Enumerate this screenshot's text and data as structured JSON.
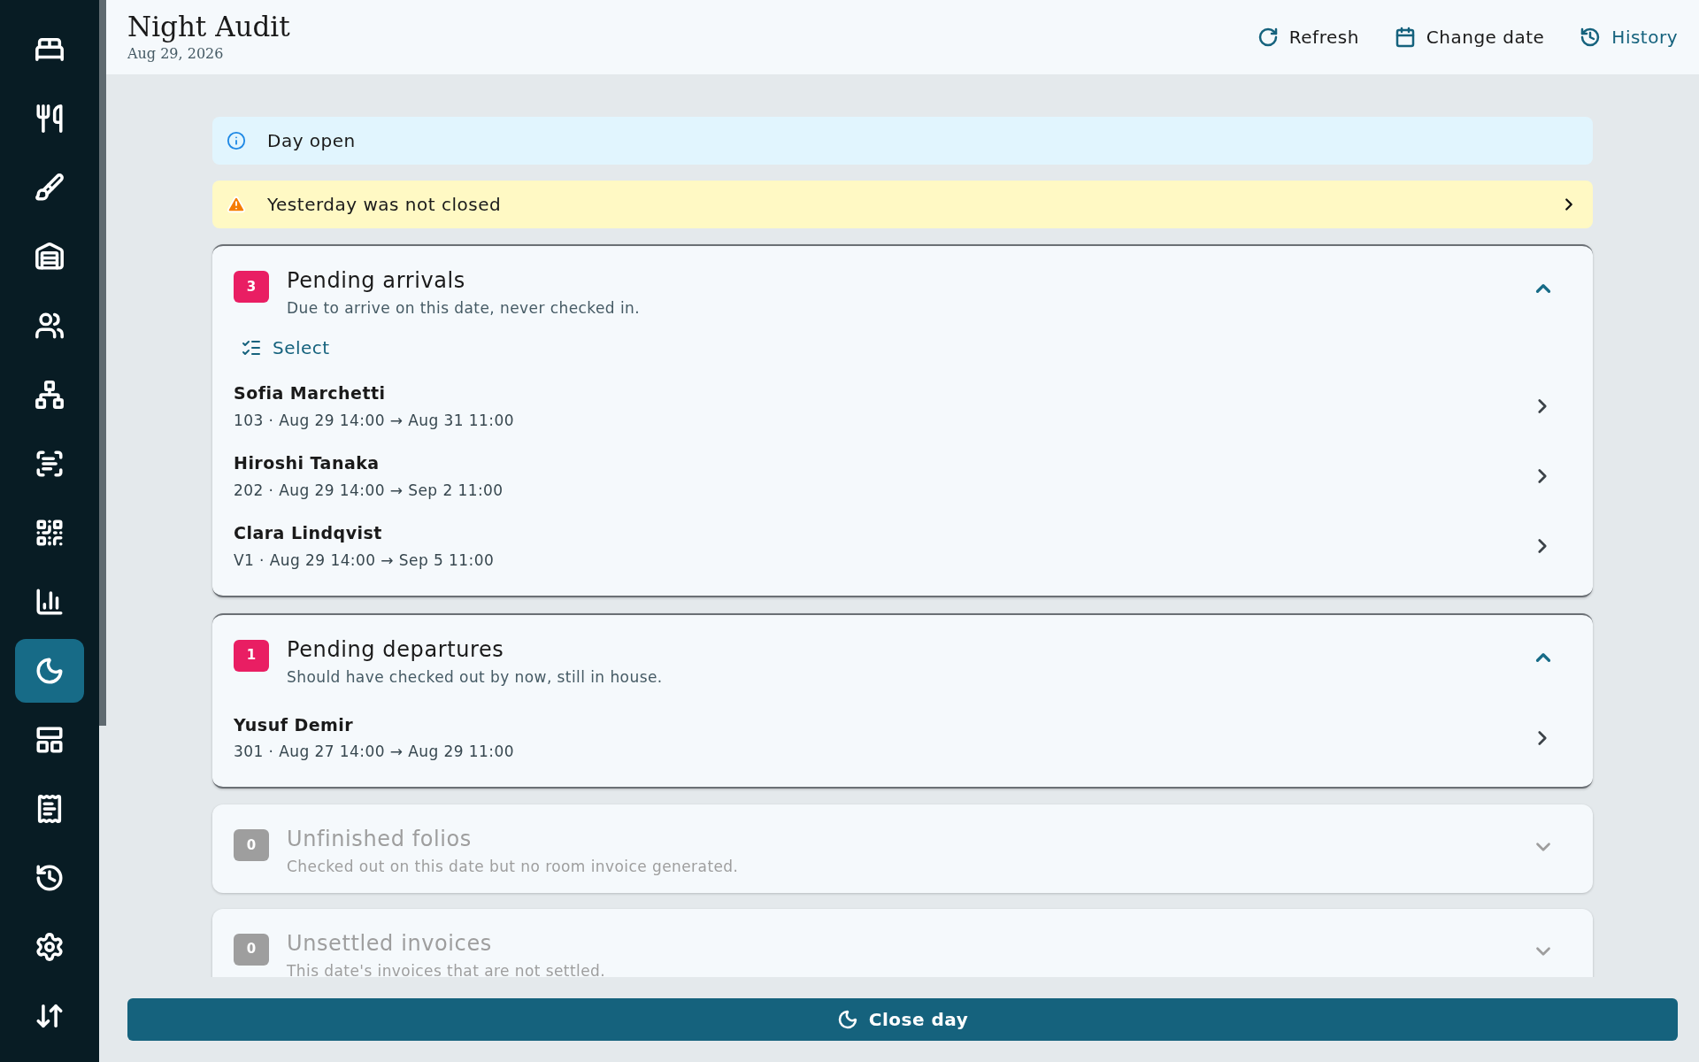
{
  "sidebar": {
    "items": [
      {
        "selected": false
      },
      {
        "selected": false
      },
      {
        "selected": false
      },
      {
        "selected": false
      },
      {
        "selected": false
      },
      {
        "selected": false
      },
      {
        "selected": false
      },
      {
        "selected": false
      },
      {
        "selected": false
      },
      {
        "selected": true
      },
      {
        "selected": false
      },
      {
        "selected": false
      },
      {
        "selected": false
      },
      {
        "selected": false
      },
      {
        "selected": false
      }
    ]
  },
  "header": {
    "title": "Night Audit",
    "date": "Aug 29, 2026",
    "actions": [
      {
        "label": "Refresh",
        "kind": "refresh",
        "accent": false
      },
      {
        "label": "Change date",
        "kind": "calendar",
        "accent": false
      },
      {
        "label": "History",
        "kind": "history",
        "accent": true
      }
    ]
  },
  "alerts": [
    {
      "kind": "info",
      "text": "Day open",
      "link": false
    },
    {
      "kind": "warning",
      "text": "Yesterday was not closed",
      "link": true
    }
  ],
  "sections": [
    {
      "count": "3",
      "title": "Pending arrivals",
      "subtitle": "Due to arrive on this date, never checked in.",
      "disabled": false,
      "expanded": true,
      "select_label": "Select",
      "items": [
        {
          "name": "Sofia Marchetti",
          "detail": "103 · Aug 29 14:00 → Aug 31 11:00"
        },
        {
          "name": "Hiroshi Tanaka",
          "detail": "202 · Aug 29 14:00 → Sep 2 11:00"
        },
        {
          "name": "Clara Lindqvist",
          "detail": "V1 · Aug 29 14:00 → Sep 5 11:00"
        }
      ]
    },
    {
      "count": "1",
      "title": "Pending departures",
      "subtitle": "Should have checked out by now, still in house.",
      "disabled": false,
      "expanded": true,
      "items": [
        {
          "name": "Yusuf Demir",
          "detail": "301 · Aug 27 14:00 → Aug 29 11:00"
        }
      ]
    },
    {
      "count": "0",
      "title": "Unfinished folios",
      "subtitle": "Checked out on this date but no room invoice generated.",
      "disabled": true,
      "expanded": false
    },
    {
      "count": "0",
      "title": "Unsettled invoices",
      "subtitle": "This date's invoices that are not settled.",
      "disabled": true,
      "expanded": false
    }
  ],
  "close_button": {
    "label": "Close day"
  }
}
